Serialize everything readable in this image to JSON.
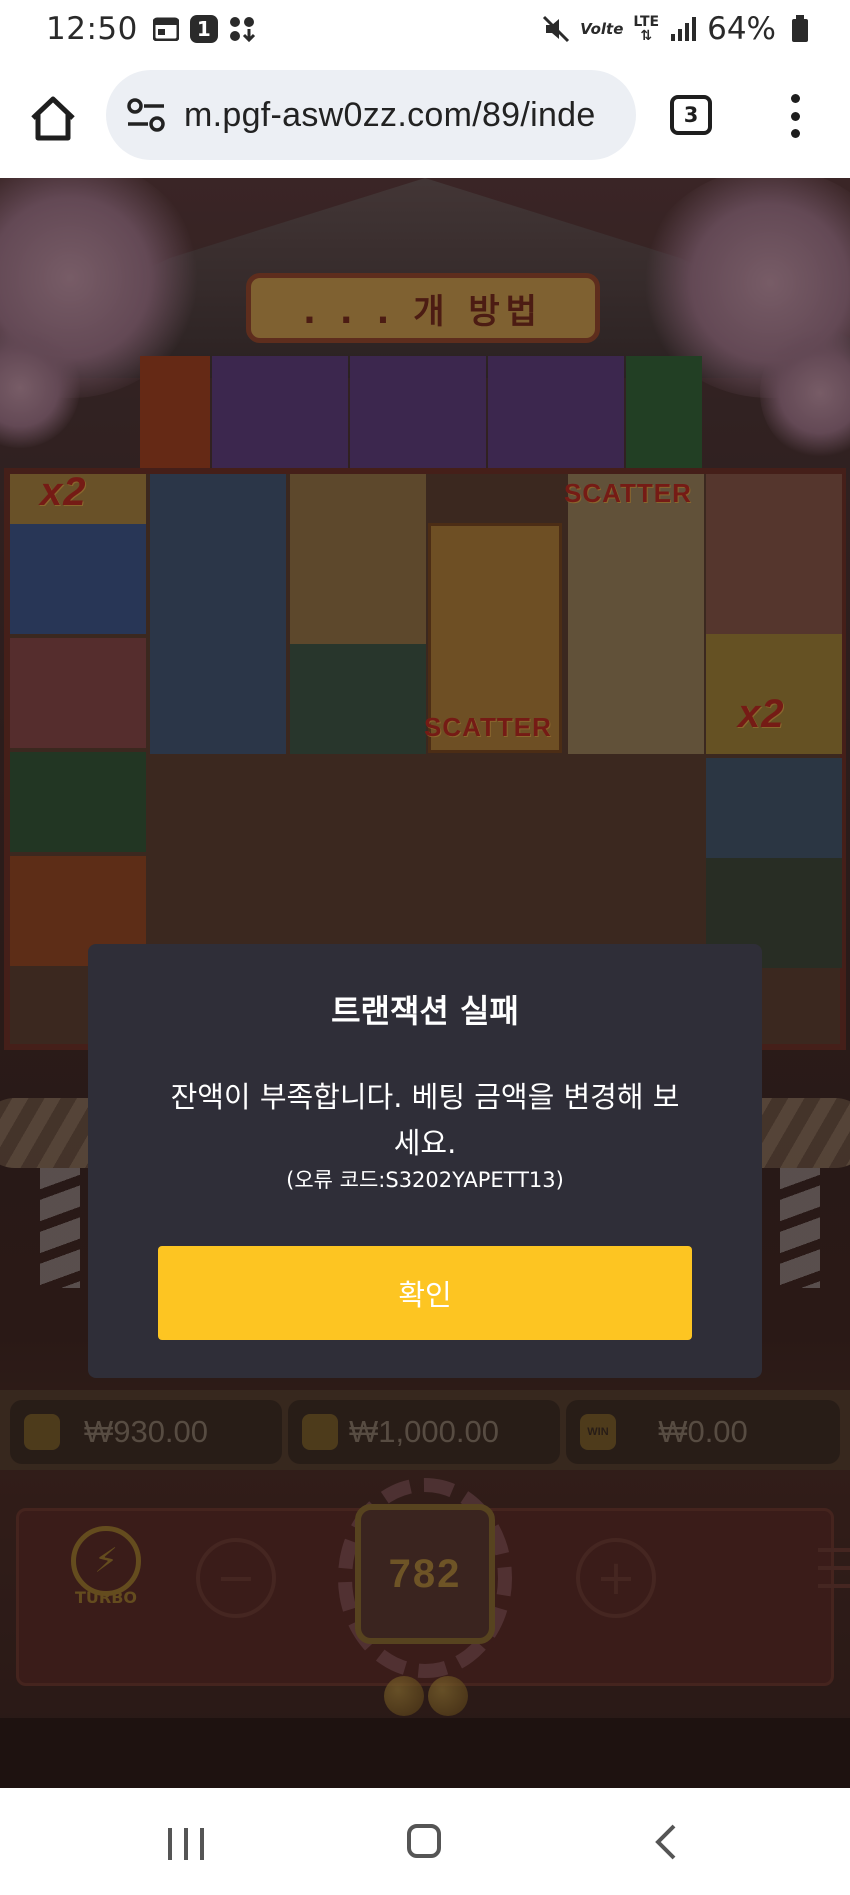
{
  "status_bar": {
    "time": "12:50",
    "notification_count": "1",
    "network_small": "Volte",
    "network_type": "LTE",
    "battery_percent": "64%",
    "icons": [
      "calendar-icon",
      "badge-icon",
      "dots-download-icon",
      "mute-icon",
      "volte-icon",
      "lte-icon",
      "signal-icon",
      "battery-icon"
    ]
  },
  "browser": {
    "url": "m.pgf-asw0zz.com/89/inde",
    "tab_count": "3",
    "icons": [
      "home-icon",
      "site-settings-icon",
      "tabs-icon",
      "more-menu-icon"
    ]
  },
  "game": {
    "title_board": ". . .  개 방법",
    "symbol_labels": {
      "x2_top_left": "x2",
      "scatter_top": "SCATTER",
      "scatter_center": "SCATTER",
      "x2_right": "x2"
    },
    "balances": {
      "wallet": "₩930.00",
      "bet": "₩1,000.00",
      "win": "₩0.00",
      "win_icon_label": "WIN"
    },
    "controls": {
      "turbo_label": "TURBO",
      "minus": "−",
      "plus": "+",
      "spin_count": "782"
    }
  },
  "dialog": {
    "title": "트랜잭션 실패",
    "message": "잔액이 부족합니다. 베팅 금액을 변경해 보세요.",
    "error_code": "(오류 코드:S3202YAPETT13)",
    "confirm_label": "확인",
    "confirm_color": "#fdc522",
    "background_color": "#2f2e38"
  },
  "nav_bar": {
    "icons": [
      "recent-apps-icon",
      "home-nav-icon",
      "back-icon"
    ]
  }
}
